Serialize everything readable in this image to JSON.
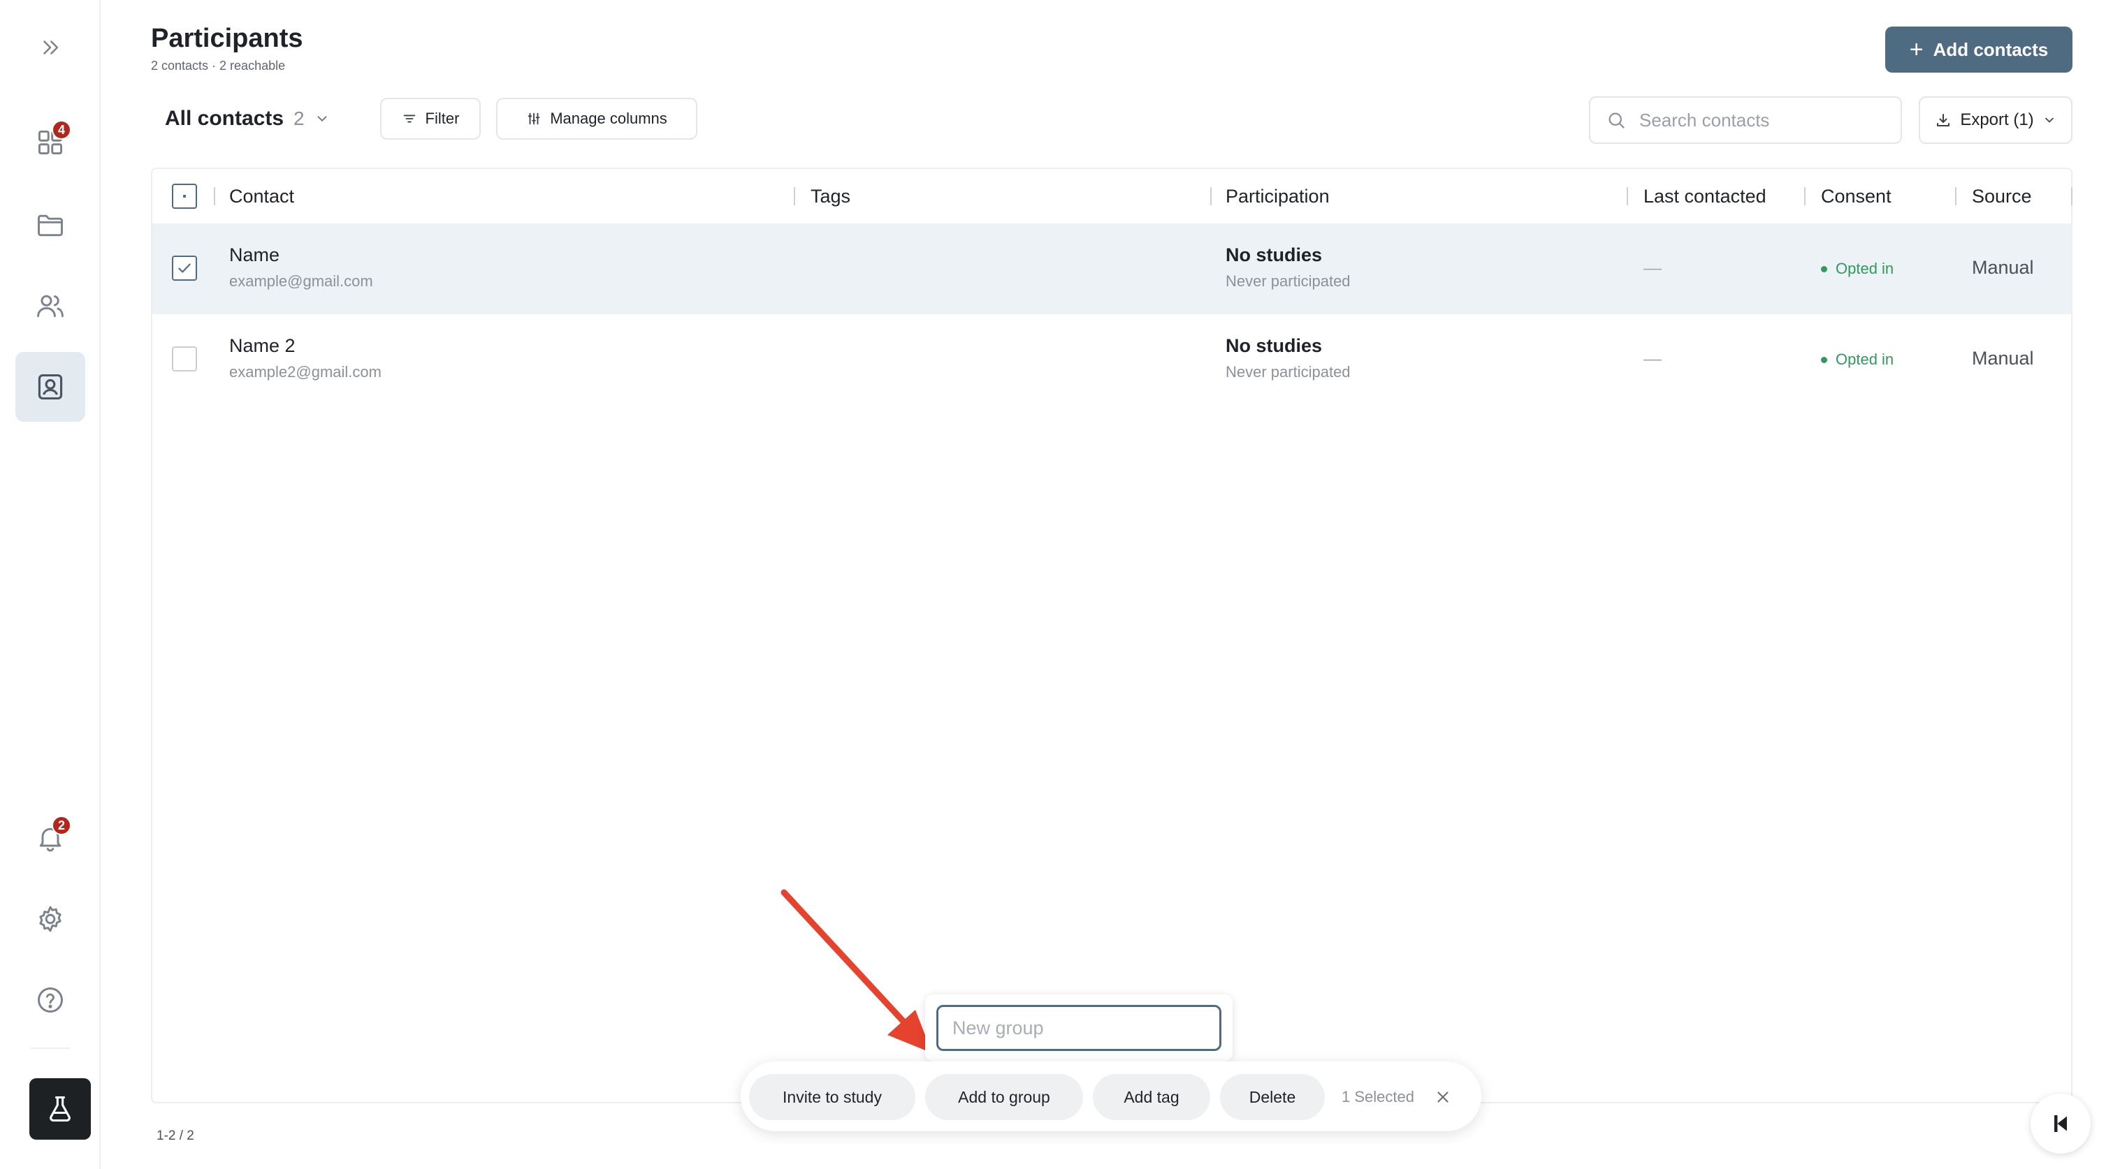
{
  "page": {
    "title": "Participants",
    "subtitle": "2 contacts · 2 reachable"
  },
  "header": {
    "add_contacts_label": "Add contacts"
  },
  "sidebar": {
    "expand_icon": "chevrons-right-icon",
    "items": [
      {
        "icon": "grid-icon",
        "badge": "4"
      },
      {
        "icon": "folder-icon"
      },
      {
        "icon": "users-icon"
      },
      {
        "icon": "contact-card-icon",
        "active": true
      }
    ],
    "bottom_items": [
      {
        "icon": "bell-icon",
        "badge": "2"
      },
      {
        "icon": "gear-icon"
      },
      {
        "icon": "help-circle-icon"
      }
    ],
    "app_logo_icon": "flask-icon"
  },
  "toolbar": {
    "view_label": "All contacts",
    "view_count": "2",
    "filter_label": "Filter",
    "manage_columns_label": "Manage columns",
    "search_placeholder": "Search contacts",
    "export_label": "Export (1)"
  },
  "table": {
    "columns": [
      "Contact",
      "Tags",
      "Participation",
      "Last contacted",
      "Consent",
      "Source"
    ],
    "rows": [
      {
        "selected": true,
        "name": "Name",
        "email": "example@gmail.com",
        "participation": "No studies",
        "participation_sub": "Never participated",
        "last_contacted": "—",
        "consent": "Opted in",
        "source": "Manual"
      },
      {
        "selected": false,
        "name": "Name 2",
        "email": "example2@gmail.com",
        "participation": "No studies",
        "participation_sub": "Never participated",
        "last_contacted": "—",
        "consent": "Opted in",
        "source": "Manual"
      }
    ]
  },
  "pager": {
    "text": "1-2 / 2"
  },
  "group_popover": {
    "placeholder": "New group"
  },
  "action_bar": {
    "invite_label": "Invite to study",
    "add_group_label": "Add to group",
    "add_tag_label": "Add tag",
    "delete_label": "Delete",
    "selected_text": "1 Selected"
  },
  "colors": {
    "accent": "#4f6b82",
    "badge": "#b3261e",
    "consent": "#2f9a5c",
    "selected_row": "#edf2f7",
    "annotation_arrow": "#e5432d"
  }
}
